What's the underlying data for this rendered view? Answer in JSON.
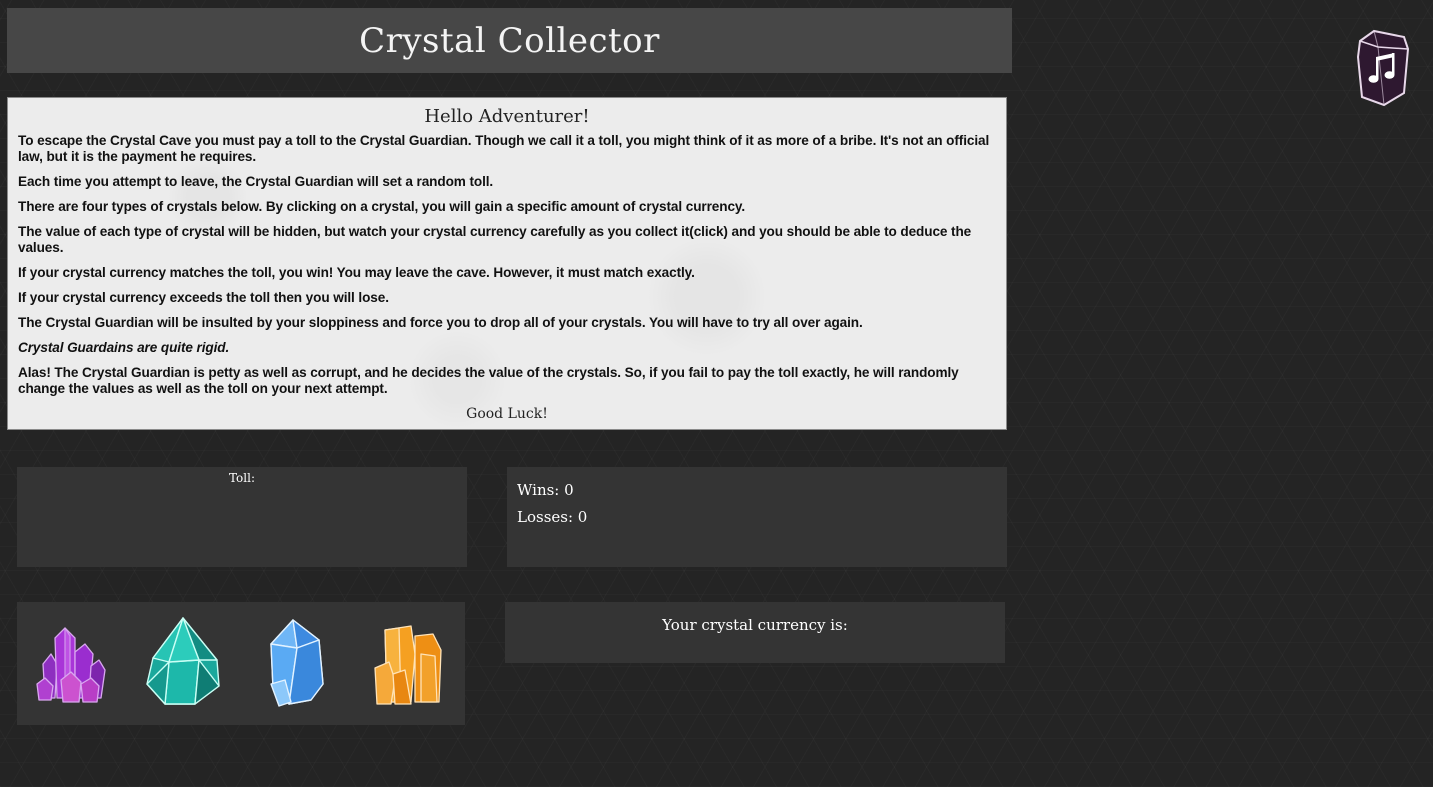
{
  "header": {
    "title": "Crystal Collector"
  },
  "music_button": {
    "icon": "music-note-icon"
  },
  "rules": {
    "heading": "Hello Adventurer!",
    "paragraphs": [
      "To escape the Crystal Cave you must pay a toll to the Crystal Guardian. Though we call it a toll, you might think of it as more of a bribe. It's not an official law, but it is the payment he requires.",
      "Each time you attempt to leave, the Crystal Guardian will set a random toll.",
      "There are four types of crystals below. By clicking on a crystal, you will gain a specific amount of crystal currency.",
      "The value of each type of crystal will be hidden, but watch your crystal currency carefully as you collect it(click) and you should be able to deduce the values.",
      "If your crystal currency matches the toll, you win! You may leave the cave. However, it must match exactly.",
      "If your crystal currency exceeds the toll then you will lose.",
      "The Crystal Guardian will be insulted by your sloppiness and force you to drop all of your crystals. You will have to try all over again.",
      "Crystal Guardains are quite rigid.",
      "Alas! The Crystal Guardian is petty as well as corrupt, and he decides the value of the crystals. So, if you fail to pay the toll exactly, he will randomly change the values as well as the toll on your next attempt."
    ],
    "closing": "Good Luck!"
  },
  "toll": {
    "label": "Toll:"
  },
  "score": {
    "wins": "Wins: 0",
    "losses": "Losses: 0"
  },
  "currency": {
    "label": "Your crystal currency is:"
  },
  "crystals": [
    {
      "name": "purple-crystal-icon",
      "color": "#9b2fc9"
    },
    {
      "name": "teal-crystal-icon",
      "color": "#1fb5a8"
    },
    {
      "name": "blue-crystal-icon",
      "color": "#4ea6f0"
    },
    {
      "name": "orange-crystal-icon",
      "color": "#f39a1e"
    }
  ]
}
